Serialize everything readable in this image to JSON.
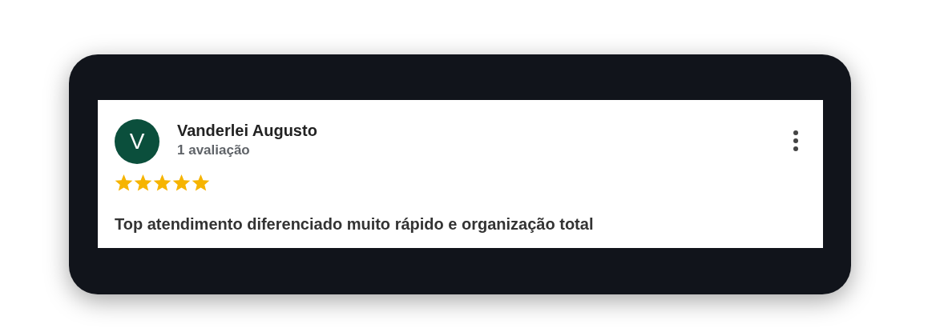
{
  "review": {
    "avatar_letter": "V",
    "author": "Vanderlei Augusto",
    "reviews_count": "1 avaliação",
    "stars": 5,
    "text": "Top atendimento diferenciado muito rápido e organização total"
  }
}
